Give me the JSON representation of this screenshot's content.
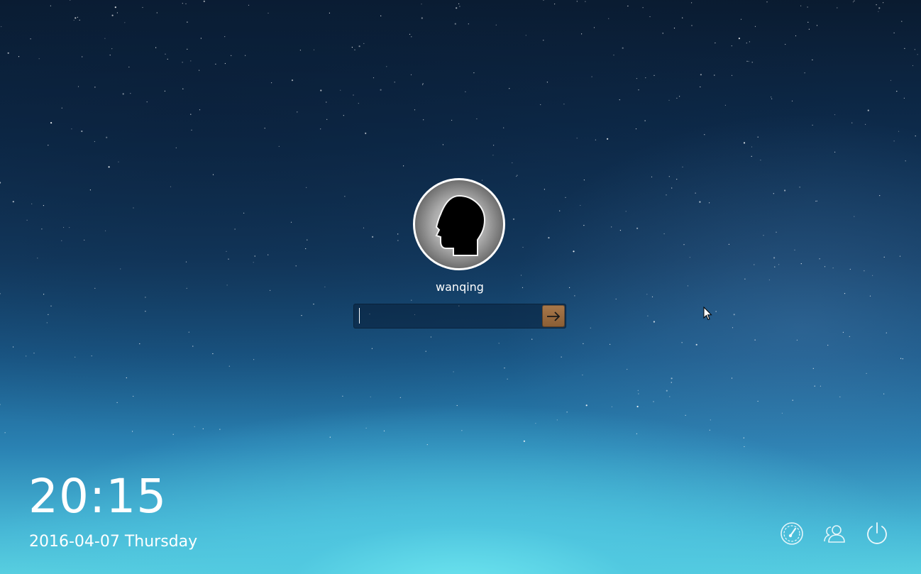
{
  "user": {
    "name": "wanqing"
  },
  "password": {
    "value": "",
    "placeholder": ""
  },
  "clock": {
    "time": "20:15",
    "date": "2016-04-07 Thursday"
  },
  "icons": {
    "submit": "arrow-right-icon",
    "avatar": "head-silhouette-icon",
    "session": "gauge-icon",
    "switch_user": "users-icon",
    "power": "power-icon"
  },
  "colors": {
    "submit_button": "#9a6b40",
    "text": "#ffffff"
  }
}
